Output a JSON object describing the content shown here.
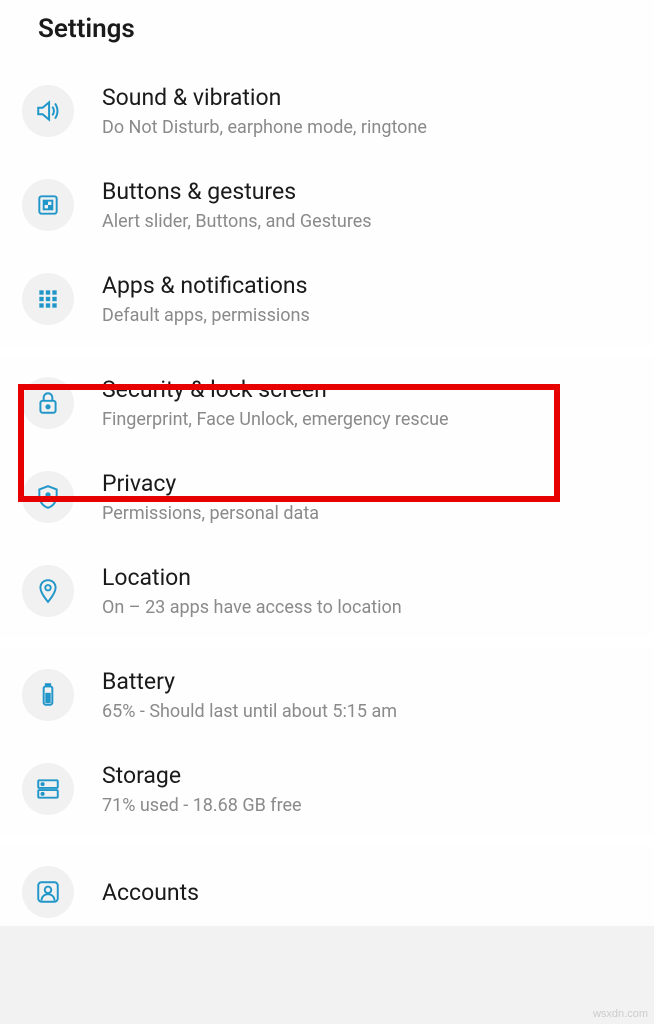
{
  "title": "Settings",
  "sections": [
    {
      "items": [
        {
          "id": "sound",
          "title": "Sound & vibration",
          "sub": "Do Not Disturb, earphone mode, ringtone"
        },
        {
          "id": "buttons",
          "title": "Buttons & gestures",
          "sub": "Alert slider, Buttons, and Gestures"
        },
        {
          "id": "apps",
          "title": "Apps & notifications",
          "sub": "Default apps, permissions"
        }
      ]
    },
    {
      "items": [
        {
          "id": "security",
          "title": "Security & lock screen",
          "sub": "Fingerprint, Face Unlock, emergency rescue"
        },
        {
          "id": "privacy",
          "title": "Privacy",
          "sub": "Permissions, personal data"
        },
        {
          "id": "location",
          "title": "Location",
          "sub": "On – 23 apps have access to location"
        }
      ]
    },
    {
      "items": [
        {
          "id": "battery",
          "title": "Battery",
          "sub": "65% - Should last until about 5:15 am"
        },
        {
          "id": "storage",
          "title": "Storage",
          "sub": "71% used - 18.68 GB free"
        }
      ]
    },
    {
      "items": [
        {
          "id": "accounts",
          "title": "Accounts",
          "sub": ""
        }
      ]
    }
  ],
  "watermark": "wsxdn.com"
}
